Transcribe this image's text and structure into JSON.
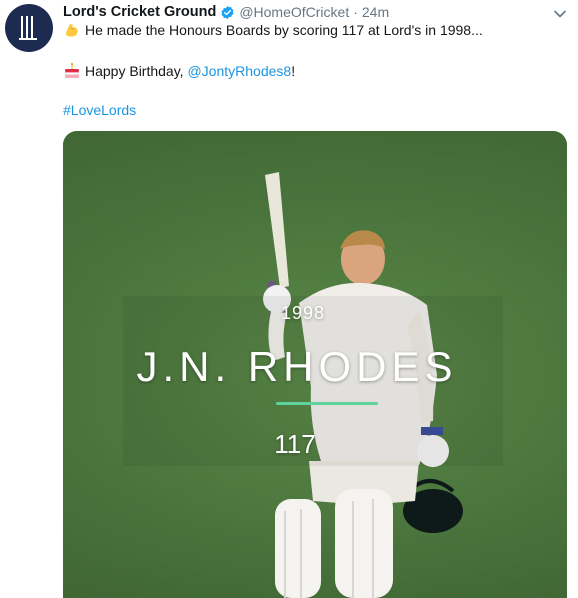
{
  "account": {
    "display_name": "Lord's Cricket Ground",
    "handle": "@HomeOfCricket",
    "separator": "·",
    "timestamp": "24m",
    "avatar_icon": "lords-logo-icon",
    "avatar_color": "#1c2b4f"
  },
  "tweet": {
    "line1": "He made the Honours Boards by scoring 117 at Lord's in 1998...",
    "line2_prefix": "Happy Birthday, ",
    "mention": "@JontyRhodes8",
    "line2_suffix": "!",
    "hashtag": "#LoveLords",
    "link_color": "#1b95e0"
  },
  "media": {
    "year": "1998",
    "player_name": "J.N. RHODES",
    "score": "117",
    "accent_color": "#5fd39c"
  }
}
